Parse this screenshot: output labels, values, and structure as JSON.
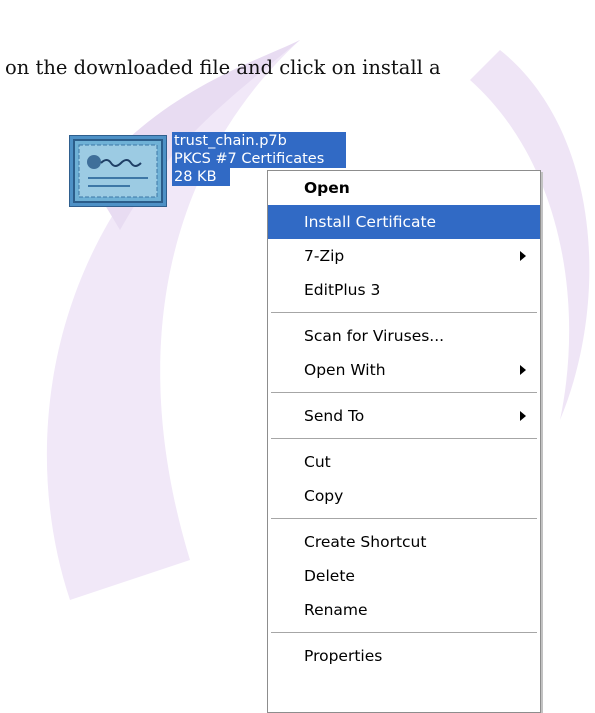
{
  "instruction": {
    "text": "on the downloaded file and click on install a"
  },
  "file": {
    "name": "trust_chain.p7b",
    "type": "PKCS #7 Certificates",
    "size": "28 KB",
    "icon": "certificate-icon"
  },
  "context_menu": {
    "items": [
      {
        "label": "Open",
        "bold": true
      },
      {
        "label": "Install Certificate",
        "highlighted": true
      },
      {
        "label": "7-Zip",
        "submenu": true
      },
      {
        "label": "EditPlus 3"
      },
      {
        "label": "Scan for Viruses..."
      },
      {
        "label": "Open With",
        "submenu": true
      },
      {
        "label": "Send To",
        "submenu": true
      },
      {
        "label": "Cut"
      },
      {
        "label": "Copy"
      },
      {
        "label": "Create Shortcut"
      },
      {
        "label": "Delete"
      },
      {
        "label": "Rename"
      },
      {
        "label": "Properties"
      }
    ]
  },
  "colors": {
    "selection": "#316ac5",
    "menu_background": "#ffffff",
    "menu_border": "#8d8d8d",
    "watermark": "#e9dcf3"
  }
}
